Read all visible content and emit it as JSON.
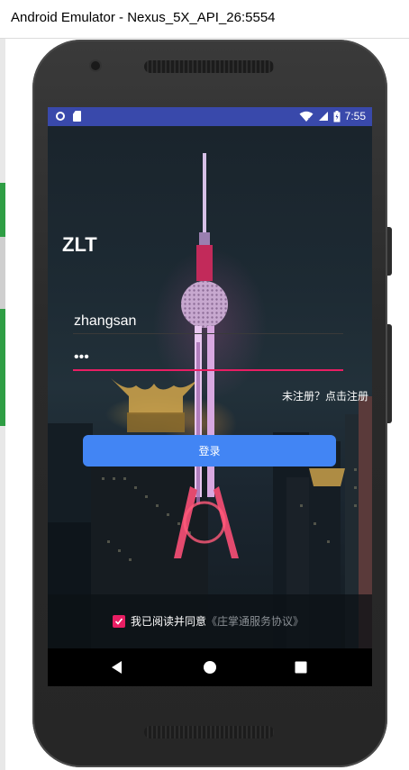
{
  "window": {
    "title": "Android Emulator - Nexus_5X_API_26:5554"
  },
  "status_bar": {
    "time": "7:55",
    "background": "#3949ab"
  },
  "app": {
    "brand": "ZLT",
    "username_value": "zhangsan",
    "password_value": "•••",
    "register_text": "未注册？点击注册",
    "login_label": "登录",
    "agree_text": "我已阅读并同意",
    "agreement_link": "《庄掌通服务协议》",
    "accent_color": "#e91e63",
    "button_color": "#4285f4"
  },
  "icons": {
    "status_left": [
      "circle-icon",
      "sd-card-icon"
    ],
    "status_right": [
      "wifi-icon",
      "signal-icon",
      "battery-icon"
    ],
    "nav": [
      "back-icon",
      "home-icon",
      "recents-icon"
    ]
  }
}
